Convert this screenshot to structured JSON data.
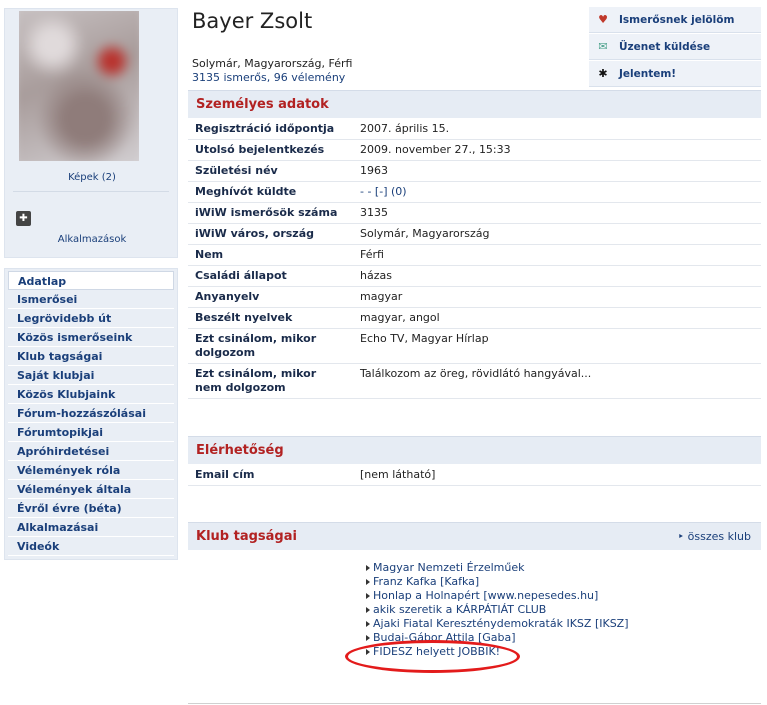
{
  "profile": {
    "name": "Bayer Zsolt",
    "location_line": "Solymár, Magyarország, Férfi",
    "stats_line": "3135 ismerős, 96 vélemény",
    "photos_link": "Képek (2)",
    "apps_link": "Alkalmazások"
  },
  "actions": [
    {
      "label": "Ismerősnek jelölöm",
      "icon": "heart-icon"
    },
    {
      "label": "Üzenet küldése",
      "icon": "mail-icon"
    },
    {
      "label": "Jelentem!",
      "icon": "flag-icon"
    }
  ],
  "menu": [
    {
      "label": "Adatlap"
    },
    {
      "label": "Ismerősei"
    },
    {
      "label": "Legrövidebb út"
    },
    {
      "label": "Közös ismerőseink"
    },
    {
      "label": "Klub tagságai"
    },
    {
      "label": "Saját klubjai"
    },
    {
      "label": "Közös Klubjaink"
    },
    {
      "label": "Fórum-hozzászólásai"
    },
    {
      "label": "Fórumtopikjai"
    },
    {
      "label": "Apróhirdetései"
    },
    {
      "label": "Vélemények róla"
    },
    {
      "label": "Vélemények általa"
    },
    {
      "label": "Évről évre (béta)"
    },
    {
      "label": "Alkalmazásai"
    },
    {
      "label": "Videók"
    }
  ],
  "personal": {
    "title": "Személyes adatok",
    "rows": [
      {
        "key": "Regisztráció időpontja",
        "value": "2007. április 15."
      },
      {
        "key": "Utolsó bejelentkezés",
        "value": "2009. november 27., 15:33"
      },
      {
        "key": "Születési név",
        "value": "1963"
      },
      {
        "key": "Meghívót küldte",
        "value": "- - [-] (0)"
      },
      {
        "key": "iWiW ismerősök száma",
        "value": "3135"
      },
      {
        "key": "iWiW város, ország",
        "value": "Solymár, Magyarország"
      },
      {
        "key": "Nem",
        "value": "Férfi"
      },
      {
        "key": "Családi állapot",
        "value": "házas"
      },
      {
        "key": "Anyanyelv",
        "value": "magyar"
      },
      {
        "key": "Beszélt nyelvek",
        "value": "magyar, angol"
      },
      {
        "key": "Ezt csinálom, mikor dolgozom",
        "value": "Echo TV, Magyar Hírlap"
      },
      {
        "key": "Ezt csinálom, mikor nem dolgozom",
        "value": "Találkozom az öreg, rövidlátó hangyával..."
      }
    ]
  },
  "contact": {
    "title": "Elérhetőség",
    "rows": [
      {
        "key": "Email cím",
        "value": "[nem látható]"
      }
    ]
  },
  "clubs": {
    "title": "Klub tagságai",
    "all_link": "összes klub",
    "items": [
      "Magyar Nemzeti Érzelműek",
      "Franz Kafka [Kafka]",
      "Honlap a Holnapért [www.nepesedes.hu]",
      "akik szeretik a KÁRPÁTIÁT CLUB",
      "Ajaki Fiatal Kereszténydemokraták IKSZ [IKSZ]",
      "Budai-Gábor Attila [Gaba]",
      "FIDESZ helyett JOBBIK!"
    ]
  },
  "colors": {
    "section_title": "#b22222",
    "link": "#1a3f7a",
    "annotation_ellipse": "#e31b1b"
  }
}
